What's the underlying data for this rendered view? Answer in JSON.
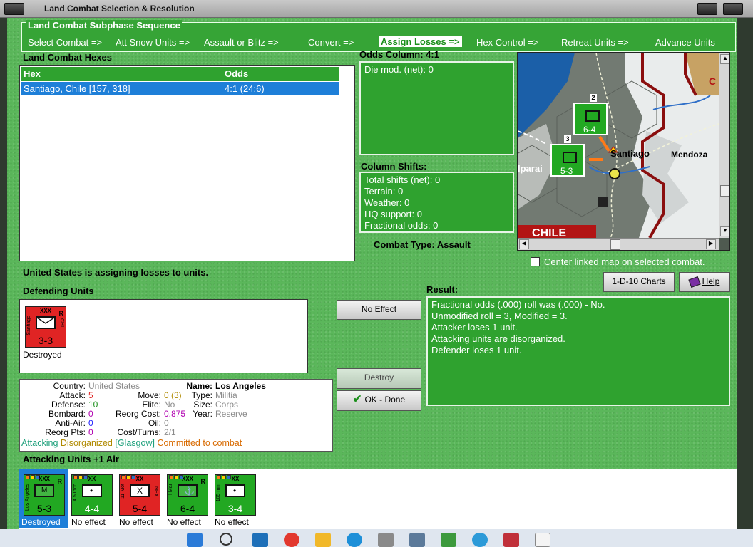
{
  "window": {
    "title": "Land Combat Selection & Resolution"
  },
  "subphase": {
    "title": "Land Combat Subphase Sequence",
    "steps": [
      "Select Combat =>",
      "Att Snow Units =>",
      "Assault or Blitz =>",
      "Convert =>",
      "Assign Losses =>",
      "Hex Control =>",
      "Retreat Units =>",
      "Advance Units"
    ],
    "selected_index": 4
  },
  "hexes": {
    "title": "Land Combat Hexes",
    "col_hex": "Hex",
    "col_odds": "Odds",
    "rows": [
      {
        "hex": "Santiago, Chile [157, 318]",
        "odds": "4:1 (24:6)"
      }
    ]
  },
  "odds": {
    "title": "Odds Column: 4:1",
    "die_mod": "Die mod. (net): 0"
  },
  "shifts": {
    "title": "Column Shifts:",
    "lines": [
      "Total shifts (net): 0",
      "Terrain: 0",
      "Weather: 0",
      "HQ support: 0",
      "Fractional odds: 0"
    ]
  },
  "combat_type": "Combat Type:  Assault",
  "map": {
    "labels": {
      "santiago": "Santiago",
      "mendoza": "Mendoza",
      "valparaiso": "lparai",
      "chile": "CHILE",
      "c": "C"
    },
    "stack1": "2",
    "stack2": "3"
  },
  "center_link": "Center linked map on selected combat.",
  "status": "United States is assigning losses to units.",
  "buttons": {
    "charts": "1-D-10 Charts",
    "help": "Help",
    "no_effect": "No Effect",
    "destroy": "Destroy",
    "ok": "OK - Done"
  },
  "defending": {
    "title": "Defending Units",
    "unit": {
      "size": "XXX",
      "flag": "R",
      "side": "CHI",
      "name": "Santiago",
      "strength": "3-3",
      "caption": "Destroyed",
      "color": "#e02424"
    }
  },
  "result": {
    "title": "Result:",
    "lines": [
      "Fractional odds (.000) roll was (.000)  - No.",
      "Unmodified roll = 3, Modified = 3.",
      "Attacker loses 1 unit.",
      "Attacking units are disorganized.",
      "Defender loses 1 unit."
    ]
  },
  "info": {
    "country_k": "Country:",
    "country_v": "United States",
    "attack_k": "Attack:",
    "attack_v": "5",
    "defense_k": "Defense:",
    "defense_v": "10",
    "bombard_k": "Bombard:",
    "bombard_v": "0",
    "antiair_k": "Anti-Air:",
    "antiair_v": "0",
    "reorg_pts_k": "Reorg Pts:",
    "reorg_pts_v": "0",
    "name_k": "Name:",
    "name_v": "Los Angeles",
    "move_k": "Move:",
    "move_v": "0 (3)",
    "elite_k": "Elite:",
    "elite_v": "No",
    "reorg_cost_k": "Reorg Cost:",
    "reorg_cost_v": "0.875",
    "oil_k": "Oil:",
    "oil_v": "0",
    "cost_k": "Cost/Turns:",
    "cost_v": "2/1",
    "type_k": "Type:",
    "type_v": "Militia",
    "size_k": "Size:",
    "size_v": "Corps",
    "year_k": "Year:",
    "year_v": "Reserve",
    "status_attacking": "Attacking",
    "status_disorganized": "Disorganized",
    "status_glasgow": "[Glasgow]",
    "status_committed": "Committed to combat"
  },
  "attacking": {
    "title": "Attacking Units +1 Air",
    "units": [
      {
        "size": "XXX",
        "flag": "R",
        "name": "Los Angeles",
        "strength": "5-3",
        "caption": "Destroyed",
        "color": "#22a822",
        "selected": true,
        "sym": "M"
      },
      {
        "size": "XX",
        "flag": "",
        "name": "4.5 Inch",
        "strength": "4-4",
        "caption": "No effect",
        "color": "#22a822",
        "selected": false,
        "sym": "•"
      },
      {
        "size": "XX",
        "flag": "NEX",
        "name": "11 Mot",
        "strength": "5-4",
        "caption": "No effect",
        "color": "#e02424",
        "selected": false,
        "sym": "X"
      },
      {
        "size": "XXX",
        "flag": "R",
        "name": "I Mar",
        "strength": "6-4",
        "caption": "No effect",
        "color": "#22a822",
        "selected": false,
        "sym": "⚓"
      },
      {
        "size": "XX",
        "flag": "",
        "name": "105 mm",
        "strength": "3-4",
        "caption": "No effect",
        "color": "#22a822",
        "selected": false,
        "sym": "•"
      }
    ]
  },
  "colors": {
    "panel_green": "#2fa22f",
    "select_blue": "#1e7fd8",
    "red_unit": "#e02424",
    "green_unit": "#22a822"
  }
}
